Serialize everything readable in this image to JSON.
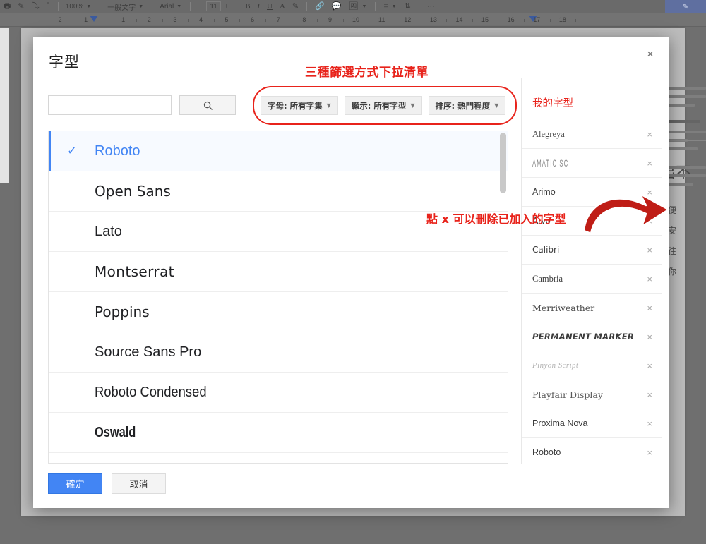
{
  "app": {
    "toolbar": {
      "zoom_value": "100%",
      "style_value": "一般文字",
      "font_value": "Arial",
      "font_size_value": "11",
      "icons": [
        "print-icon",
        "paint-format-icon",
        "spelling-check-icon",
        "undo-redo-icon",
        "bold-icon",
        "italic-icon",
        "underline-icon",
        "text-color-icon",
        "highlight-color-icon",
        "insert-link-icon",
        "insert-comment-icon",
        "insert-image-icon",
        "align-icon",
        "line-spacing-icon",
        "more-options-icon",
        "edit-mode-pen-icon"
      ]
    },
    "ruler": {
      "left_labels": [
        "2",
        "1"
      ],
      "labels": [
        "1",
        "2",
        "3",
        "4",
        "5",
        "6",
        "7",
        "8",
        "9",
        "10",
        "11",
        "12",
        "13",
        "14",
        "15",
        "16",
        "17",
        "18"
      ]
    },
    "document": {
      "heading": "推出不",
      "lines": [
        "式可方便",
        "在沒有安",
        "只需前往",
        "可變更你"
      ]
    }
  },
  "dialog": {
    "title": "字型",
    "close_label": "×",
    "search": {
      "value": "",
      "placeholder": "",
      "button_icon": "search-icon"
    },
    "filters": [
      {
        "label": "字母: 所有字集",
        "name": "script-filter"
      },
      {
        "label": "顯示: 所有字型",
        "name": "show-filter"
      },
      {
        "label": "排序: 熱門程度",
        "name": "sort-filter"
      }
    ],
    "font_list": [
      {
        "name": "Roboto",
        "selected": true,
        "cls": "f-roboto"
      },
      {
        "name": "Open Sans",
        "selected": false,
        "cls": "f-opensans"
      },
      {
        "name": "Lato",
        "selected": false,
        "cls": "f-lato"
      },
      {
        "name": "Montserrat",
        "selected": false,
        "cls": "f-mont"
      },
      {
        "name": "Poppins",
        "selected": false,
        "cls": "f-poppins"
      },
      {
        "name": "Source Sans Pro",
        "selected": false,
        "cls": "f-ssp"
      },
      {
        "name": "Roboto Condensed",
        "selected": false,
        "cls": "f-robcond"
      },
      {
        "name": "Oswald",
        "selected": false,
        "cls": "f-oswald"
      }
    ],
    "my_fonts": {
      "title": "我的字型",
      "remove_label": "×",
      "items": [
        {
          "name": "Alegreya",
          "cls": "m-alegreya"
        },
        {
          "name": "Amatic SC",
          "cls": "m-amatic"
        },
        {
          "name": "Arimo",
          "cls": "m-arimo"
        },
        {
          "name": "Arvo",
          "cls": "m-arimo"
        },
        {
          "name": "Calibri",
          "cls": "m-calibri"
        },
        {
          "name": "Cambria",
          "cls": "m-cambria"
        },
        {
          "name": "Merriweather",
          "cls": "m-merri"
        },
        {
          "name": "Permanent Marker",
          "cls": "m-permmark"
        },
        {
          "name": "Pinyon Script",
          "cls": "m-pinyon"
        },
        {
          "name": "Playfair Display",
          "cls": "m-playfair"
        },
        {
          "name": "Proxima Nova",
          "cls": "m-proxima"
        },
        {
          "name": "Roboto",
          "cls": "m-roboto"
        }
      ]
    },
    "buttons": {
      "ok": "確定",
      "cancel": "取消"
    }
  },
  "annotations": {
    "filters_note": "三種篩選方式下拉清單",
    "delete_note": "點 x 可以刪除已加入的字型",
    "color": "#e8231b"
  }
}
